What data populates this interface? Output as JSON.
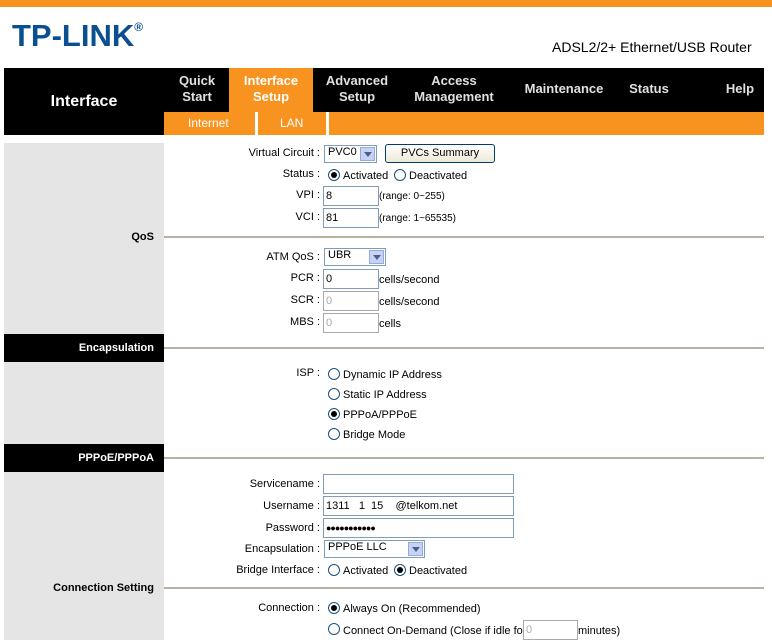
{
  "brand": {
    "logo_text": "TP-LINK",
    "registered": "®",
    "model": "ADSL2/2+ Ethernet/USB Router"
  },
  "colors": {
    "accent": "#f7931e",
    "dark": "#000000",
    "panel": "#e5e5e5"
  },
  "sidebar": {
    "section_title": "Interface"
  },
  "nav": {
    "tabs": [
      {
        "line1": "Quick",
        "line2": "Start"
      },
      {
        "line1": "Interface",
        "line2": "Setup",
        "active": true
      },
      {
        "line1": "Advanced",
        "line2": "Setup"
      },
      {
        "line1": "Access",
        "line2": "Management"
      },
      {
        "line1": "Maintenance",
        "line2": ""
      },
      {
        "line1": "Status",
        "line2": ""
      },
      {
        "line1": "Help",
        "line2": ""
      }
    ],
    "subtabs": [
      "Internet",
      "LAN"
    ]
  },
  "qos": {
    "section_label": "QoS",
    "virtual_circuit_label": "Virtual Circuit :",
    "virtual_circuit_value": "PVC0",
    "pvcs_summary_button": "PVCs Summary",
    "status_label": "Status :",
    "status_activated": "Activated",
    "status_deactivated": "Deactivated",
    "vpi_label": "VPI :",
    "vpi_value": "8",
    "vpi_range": "(range: 0~255)",
    "vci_label": "VCI :",
    "vci_value": "81",
    "vci_range": "(range: 1~65535)",
    "atm_qos_label": "ATM QoS :",
    "atm_qos_value": "UBR",
    "pcr_label": "PCR :",
    "pcr_value": "0",
    "scr_label": "SCR :",
    "scr_value": "0",
    "mbs_label": "MBS :",
    "mbs_value": "0",
    "cells_per_second": "cells/second",
    "cells": "cells"
  },
  "encapsulation": {
    "section_label": "Encapsulation",
    "isp_label": "ISP :",
    "options": [
      "Dynamic IP Address",
      "Static IP Address",
      "PPPoA/PPPoE",
      "Bridge Mode"
    ],
    "selected": "PPPoA/PPPoE"
  },
  "pppoe": {
    "section_label": "PPPoE/PPPoA",
    "servicename_label": "Servicename :",
    "servicename_value": "",
    "username_label": "Username :",
    "username_value": "1311   1  15    @telkom.net",
    "password_label": "Password :",
    "password_value": "●●●●●●●●●●●",
    "encapsulation_label": "Encapsulation :",
    "encapsulation_value": "PPPoE LLC",
    "bridge_label": "Bridge Interface :",
    "bridge_activated": "Activated",
    "bridge_deactivated": "Deactivated"
  },
  "connection": {
    "section_label": "Connection Setting",
    "connection_label": "Connection :",
    "always_on": "Always On (Recommended)",
    "on_demand_prefix": "Connect On-Demand (Close if idle for",
    "idle_value": "0",
    "on_demand_suffix": "minutes)"
  }
}
